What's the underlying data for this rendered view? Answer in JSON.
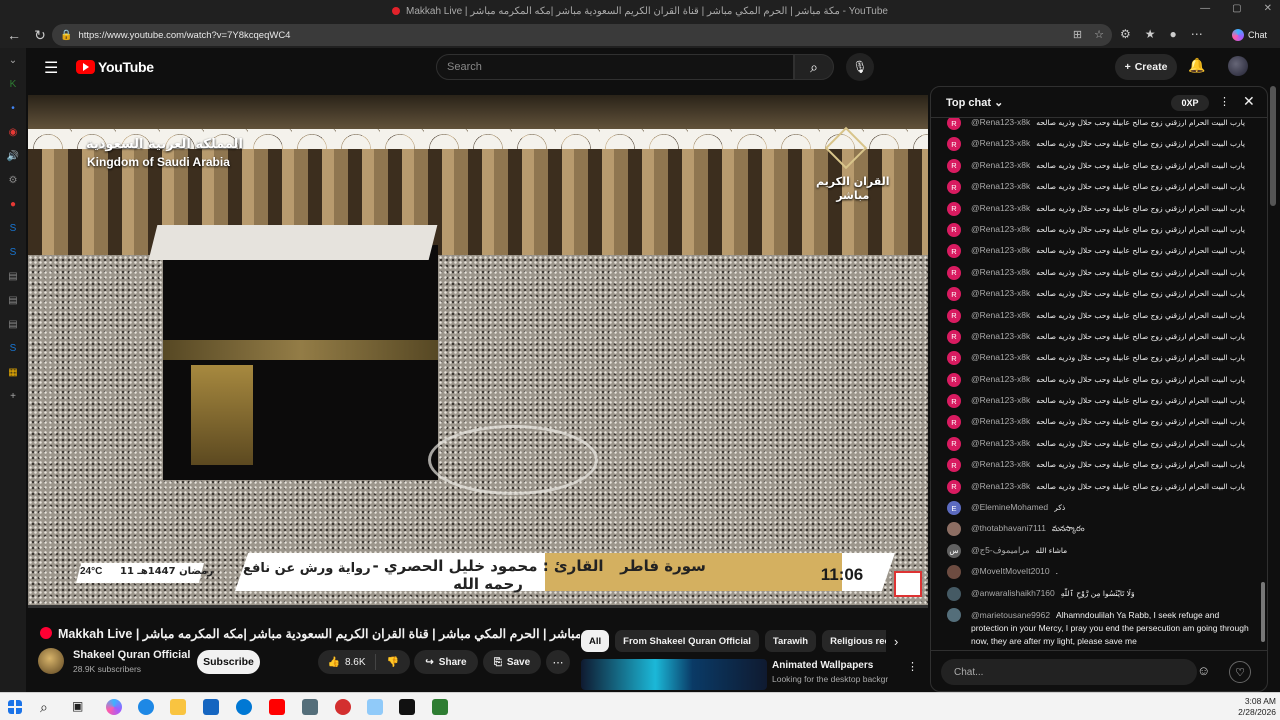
{
  "browser": {
    "tab_title": "Makkah Live | مكة مباشر | الحرم المكي مباشر | قناة القران الكريم السعودية مباشر |مكه المكرمه مباشر - YouTube",
    "url": "https://www.youtube.com/watch?v=7Y8kcqeqWC4",
    "copilot_label": "Chat"
  },
  "header": {
    "logo_text": "YouTube",
    "search_placeholder": "Search",
    "create_label": "Create"
  },
  "video": {
    "overlay_ar_country": "المملكة العربية السعودية",
    "overlay_en_country": "Kingdom of Saudi Arabia",
    "overlay_channel_l1": "القران الكريم",
    "overlay_channel_l2": "مباشر",
    "overlay_riwaya": "رواية ورش عن نافع",
    "overlay_reciter": "القارئ : محمود خليل الحصري - رحمه الله",
    "overlay_surah": "سورة فاطر",
    "overlay_time": "11:06",
    "overlay_temp": "24°C",
    "overlay_hijri": "11 رمضان 1447هـ",
    "title": "Makkah Live | مكة مباشر | الحرم المكي مباشر | قناة القران الكريم السعودية مباشر |مكه المكرمه مباشر",
    "channel_name": "Shakeel Quran Official",
    "subscribers": "28.9K subscribers",
    "subscribe_label": "Subscribe",
    "like_count": "8.6K",
    "share_label": "Share",
    "save_label": "Save"
  },
  "chips": [
    {
      "label": "All",
      "active": true
    },
    {
      "label": "From Shakeel Quran Official"
    },
    {
      "label": "Tarawih"
    },
    {
      "label": "Religious recitat"
    }
  ],
  "recommendation": {
    "title": "Animated Wallpapers",
    "desc": "Looking for the desktop backgrounds? Explore a curated"
  },
  "chat": {
    "mode": "Top chat",
    "xp": "0XP",
    "input_placeholder": "Chat...",
    "messages": [
      {
        "author": "@Rena123-x8k",
        "text": "يارب البيت الحرام ارزقني زوج صالح عابيلة وحب حلال وذريه صالحه",
        "avatar": "R",
        "color": "#d81b60"
      },
      {
        "author": "@Rena123-x8k",
        "text": "يارب البيت الحرام ارزقني زوج صالح عابيلة وحب حلال وذريه صالحه",
        "avatar": "R",
        "color": "#d81b60"
      },
      {
        "author": "@Rena123-x8k",
        "text": "يارب البيت الحرام ارزقني زوج صالح عابيلة وحب حلال وذريه صالحه",
        "avatar": "R",
        "color": "#d81b60"
      },
      {
        "author": "@Rena123-x8k",
        "text": "يارب البيت الحرام ارزقني زوج صالح عابيلة وحب حلال وذريه صالحه",
        "avatar": "R",
        "color": "#d81b60"
      },
      {
        "author": "@Rena123-x8k",
        "text": "يارب البيت الحرام ارزقني زوج صالح عابيلة وحب حلال وذريه صالحه",
        "avatar": "R",
        "color": "#d81b60"
      },
      {
        "author": "@Rena123-x8k",
        "text": "يارب البيت الحرام ارزقني زوج صالح عابيلة وحب حلال وذريه صالحه",
        "avatar": "R",
        "color": "#d81b60"
      },
      {
        "author": "@Rena123-x8k",
        "text": "يارب البيت الحرام ارزقني زوج صالح عابيلة وحب حلال وذريه صالحه",
        "avatar": "R",
        "color": "#d81b60"
      },
      {
        "author": "@Rena123-x8k",
        "text": "يارب البيت الحرام ارزقني زوج صالح عابيلة وحب حلال وذريه صالحه",
        "avatar": "R",
        "color": "#d81b60"
      },
      {
        "author": "@Rena123-x8k",
        "text": "يارب البيت الحرام ارزقني زوج صالح عابيلة وحب حلال وذريه صالحه",
        "avatar": "R",
        "color": "#d81b60"
      },
      {
        "author": "@Rena123-x8k",
        "text": "يارب البيت الحرام ارزقني زوج صالح عابيلة وحب حلال وذريه صالحه",
        "avatar": "R",
        "color": "#d81b60"
      },
      {
        "author": "@Rena123-x8k",
        "text": "يارب البيت الحرام ارزقني زوج صالح عابيلة وحب حلال وذريه صالحه",
        "avatar": "R",
        "color": "#d81b60"
      },
      {
        "author": "@Rena123-x8k",
        "text": "يارب البيت الحرام ارزقني زوج صالح عابيلة وحب حلال وذريه صالحه",
        "avatar": "R",
        "color": "#d81b60"
      },
      {
        "author": "@Rena123-x8k",
        "text": "يارب البيت الحرام ارزقني زوج صالح عابيلة وحب حلال وذريه صالحه",
        "avatar": "R",
        "color": "#d81b60"
      },
      {
        "author": "@Rena123-x8k",
        "text": "يارب البيت الحرام ارزقني زوج صالح عابيلة وحب حلال وذريه صالحه",
        "avatar": "R",
        "color": "#d81b60"
      },
      {
        "author": "@Rena123-x8k",
        "text": "يارب البيت الحرام ارزقني زوج صالح عابيلة وحب حلال وذريه صالحه",
        "avatar": "R",
        "color": "#d81b60"
      },
      {
        "author": "@Rena123-x8k",
        "text": "يارب البيت الحرام ارزقني زوج صالح عابيلة وحب حلال وذريه صالحه",
        "avatar": "R",
        "color": "#d81b60"
      },
      {
        "author": "@Rena123-x8k",
        "text": "يارب البيت الحرام ارزقني زوج صالح عابيلة وحب حلال وذريه صالحه",
        "avatar": "R",
        "color": "#d81b60"
      },
      {
        "author": "@Rena123-x8k",
        "text": "يارب البيت الحرام ارزقني زوج صالح عابيلة وحب حلال وذريه صالحه",
        "avatar": "R",
        "color": "#d81b60"
      },
      {
        "author": "@ElemineMohamed",
        "text": "ذكر",
        "avatar": "E",
        "color": "#5c6bc0"
      },
      {
        "author": "@thotabhavani7111",
        "text": "మనస్కారం",
        "avatar": "",
        "color": "#8d6e63"
      },
      {
        "author": "@مراميموف-5ج",
        "text": "ماشاء الله",
        "avatar": "س",
        "color": "#616161"
      },
      {
        "author": "@MoveItMoveIt2010",
        "text": ".",
        "avatar": "",
        "color": "#6d4c41"
      },
      {
        "author": "@anwaralishaikh7160",
        "text": "وَلَا تَايْئَسُوا مِن رَّوْحِ ٱللَّهِ",
        "avatar": "",
        "color": "#455a64"
      },
      {
        "author": "@marietousane9962",
        "text": "Alhamndoulilah Ya Rabb, I seek refuge and protection in your Mercy, I pray you end the persecution am going through now, they are after my light, please save me",
        "avatar": "",
        "color": "#546e7a",
        "wrap": true
      }
    ]
  },
  "taskbar": {
    "time": "3:08 AM",
    "date": "2/28/2026"
  }
}
